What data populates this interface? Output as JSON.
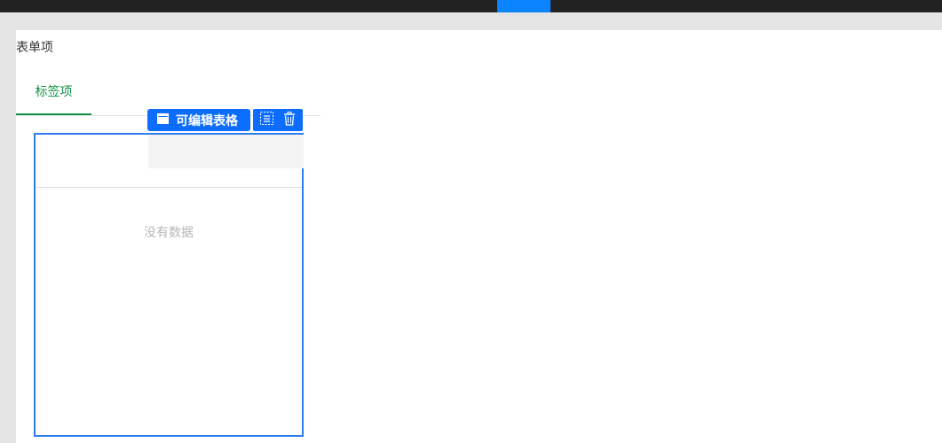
{
  "app": {
    "accent_color": "#0a84ff",
    "primary_color": "#0d6efd",
    "tab_active_color": "#17924a"
  },
  "form": {
    "title": "表单项"
  },
  "tabs": [
    {
      "label": "标签项",
      "active": true
    }
  ],
  "widget": {
    "type_label": "可编辑表格",
    "icon": "table-icon",
    "actions": [
      {
        "name": "copy",
        "icon": "copy-icon"
      },
      {
        "name": "delete",
        "icon": "trash-icon"
      }
    ]
  },
  "table": {
    "empty_text": "没有数据"
  }
}
